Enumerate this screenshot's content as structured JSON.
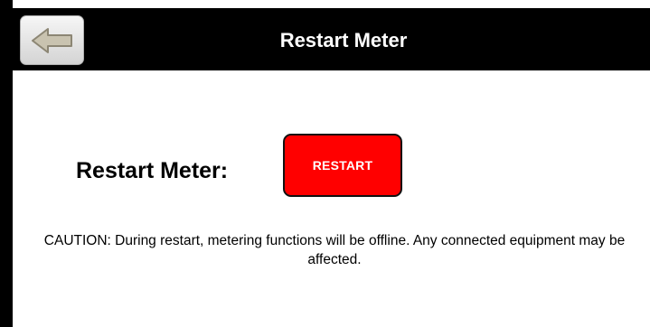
{
  "header": {
    "title": "Restart Meter",
    "back_icon": "back-arrow-icon"
  },
  "restart_row": {
    "label": "Restart Meter:",
    "button_label": "RESTART",
    "button_color": "#ff0000"
  },
  "caution": {
    "text": "CAUTION: During restart, metering functions will be offline. Any connected equipment may be affected."
  }
}
